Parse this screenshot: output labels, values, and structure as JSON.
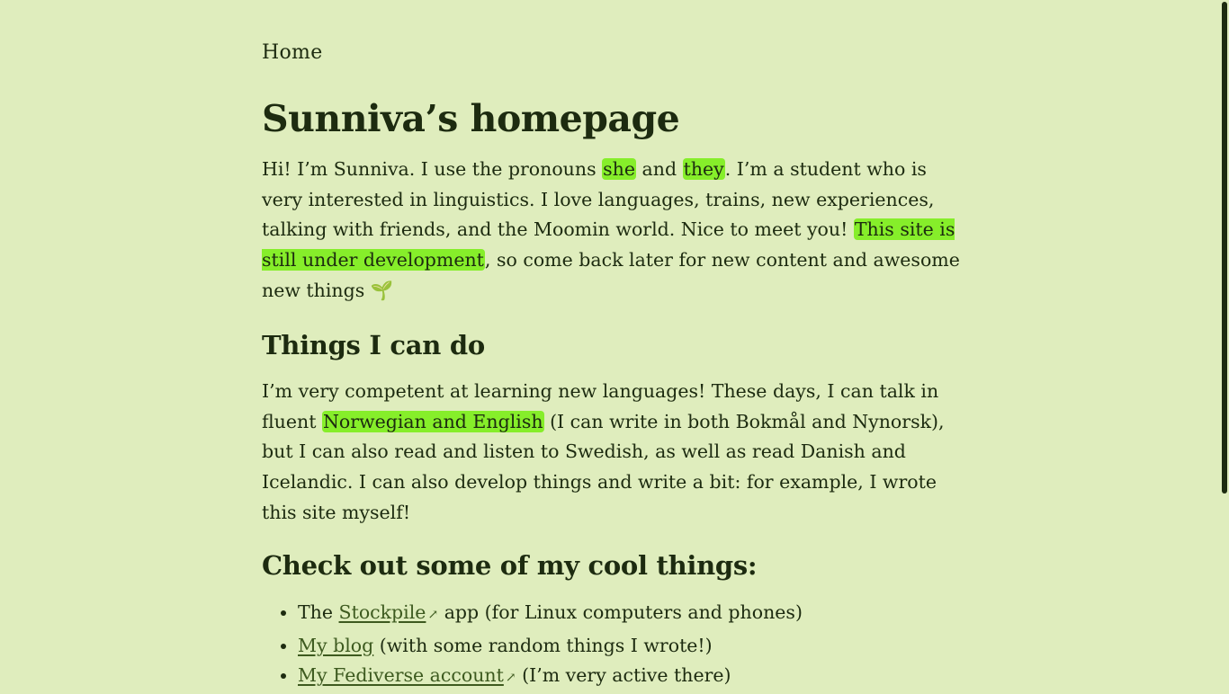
{
  "nav": {
    "home_label": "Home"
  },
  "title": "Sunniva’s homepage",
  "intro": {
    "part1": "Hi! I’m Sunniva. I use the pronouns ",
    "pronoun1": "she",
    "part2": " and ",
    "pronoun2": "they",
    "part3": ". I’m a student who is very interested in linguistics. I love languages, trains, new experiences, talking with friends, and the Moomin world. Nice to meet you! ",
    "highlight": "This site is still under development",
    "part4": ", so come back later for new content and awesome new things 🌱"
  },
  "things_heading": "Things I can do",
  "abilities": {
    "part1": "I’m very competent at learning new languages! These days, I can talk in fluent ",
    "highlight": "Norwegian and English",
    "part2": " (I can write in both Bokmål and Nynorsk), but I can also read and listen to Swedish, as well as read Danish and Icelandic. I can also develop things and write a bit: for example, I wrote this site myself!"
  },
  "cool_heading": "Check out some of my cool things:",
  "cool_items": [
    {
      "before": "The ",
      "link": "Stockpile",
      "external_icon": "↗",
      "after": " app (for Linux computers and phones)"
    },
    {
      "before": "",
      "link": "My blog",
      "external_icon": "",
      "after": " (with some random things I wrote!)"
    },
    {
      "before": "",
      "link": "My Fediverse account",
      "external_icon": "↗",
      "after": " (I’m very active there)"
    }
  ],
  "colors": {
    "background": "#dfedbd",
    "text": "#1d2b10",
    "highlight": "#86ee2a",
    "link": "#3d5a1f"
  }
}
